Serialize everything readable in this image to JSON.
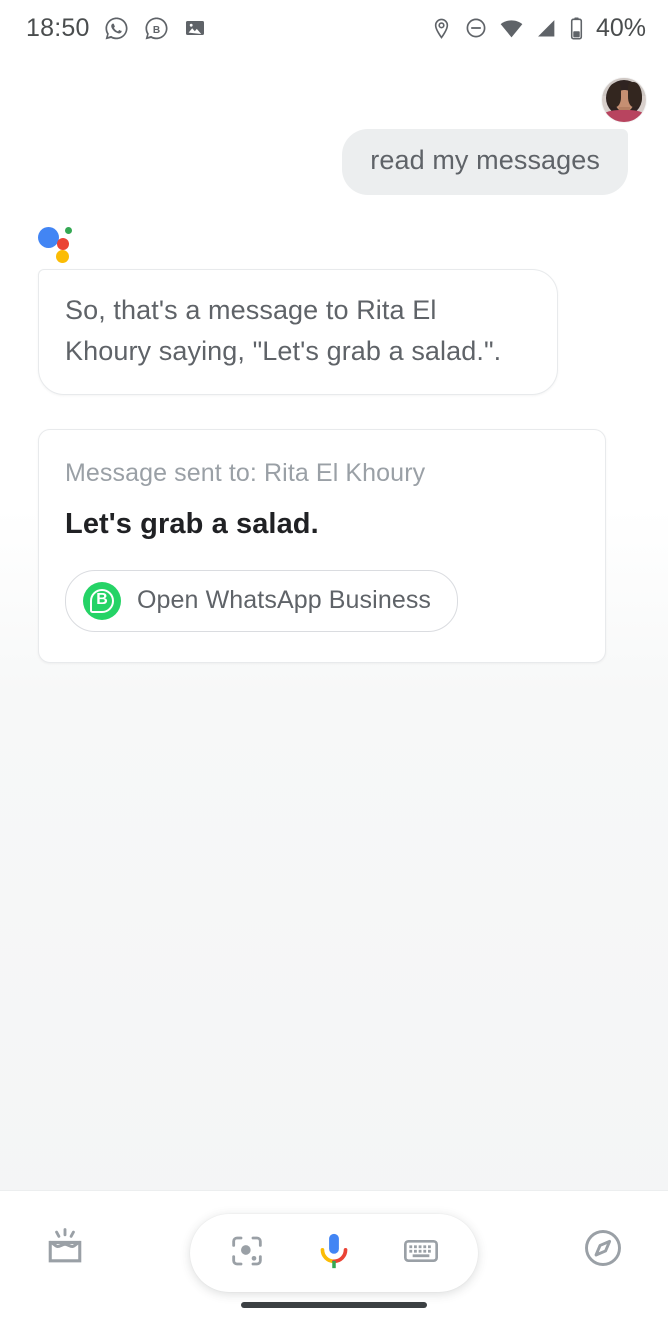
{
  "status_bar": {
    "time": "18:50",
    "battery_percent": "40%",
    "left_icons": [
      "whatsapp-icon",
      "whatsapp-business-icon",
      "photo-icon"
    ],
    "right_icons": [
      "location-icon",
      "do-not-disturb-icon",
      "wifi-icon",
      "cellular-signal-icon",
      "battery-icon"
    ]
  },
  "conversation": {
    "avatar_name": "user-avatar",
    "user_message": "read my messages",
    "assistant_message": "So, that's a message to Rita El Khoury saying, \"Let's grab a salad.\".",
    "assistant_logo": "google-assistant-logo"
  },
  "result_card": {
    "subtitle": "Message sent to: Rita El Khoury",
    "message": "Let's grab a salad.",
    "action_label": "Open WhatsApp Business",
    "action_icon": "whatsapp-business-icon"
  },
  "bottom_bar": {
    "snapshot_icon": "snapshot-icon",
    "lens_icon": "google-lens-icon",
    "mic_icon": "google-mic-icon",
    "keyboard_icon": "keyboard-icon",
    "explore_icon": "explore-compass-icon"
  },
  "colors": {
    "google_blue": "#4285f4",
    "google_red": "#ea4335",
    "google_yellow": "#fbbc05",
    "google_green": "#34a853",
    "whatsapp_green": "#25d366",
    "text_primary": "#202124",
    "text_secondary": "#5f6368",
    "text_muted": "#9aa0a6",
    "bubble_gray": "#eceeef"
  }
}
